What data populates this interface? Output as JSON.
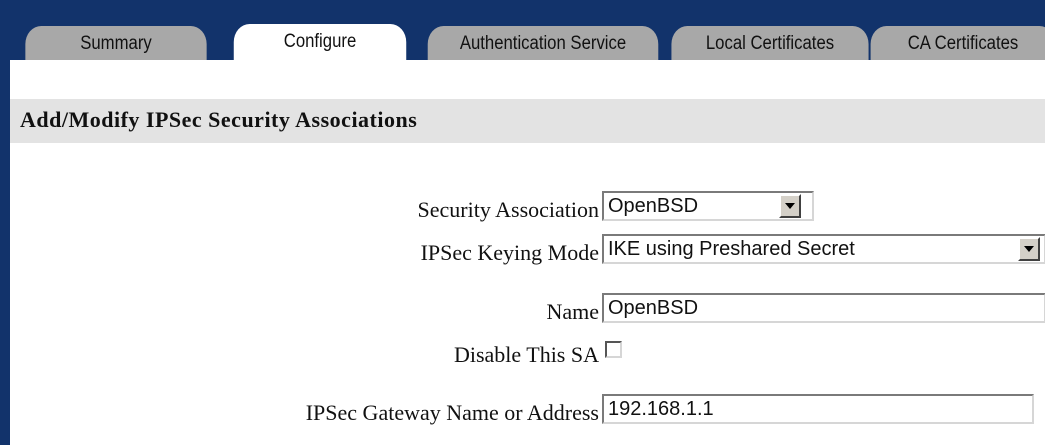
{
  "tabs": [
    {
      "label": "Summary",
      "active": false
    },
    {
      "label": "Configure",
      "active": true
    },
    {
      "label": "Authentication Service",
      "active": false
    },
    {
      "label": "Local Certificates",
      "active": false
    },
    {
      "label": "CA Certificates",
      "active": false
    }
  ],
  "panel": {
    "title": "Add/Modify IPSec Security Associations"
  },
  "form": {
    "security_association": {
      "label": "Security Association",
      "value": "OpenBSD"
    },
    "keying_mode": {
      "label": "IPSec Keying Mode",
      "value": "IKE using Preshared Secret"
    },
    "name": {
      "label": "Name",
      "value": "OpenBSD"
    },
    "disable_sa": {
      "label": "Disable This SA",
      "checked": false
    },
    "gateway": {
      "label": "IPSec Gateway Name or Address",
      "value": "192.168.1.1"
    }
  },
  "colors": {
    "frame": "#12336b",
    "tab_inactive": "#a8a8a8",
    "tab_active": "#ffffff",
    "header_band": "#e3e3e3"
  },
  "icons": {
    "dropdown": "chevron-down-icon"
  }
}
